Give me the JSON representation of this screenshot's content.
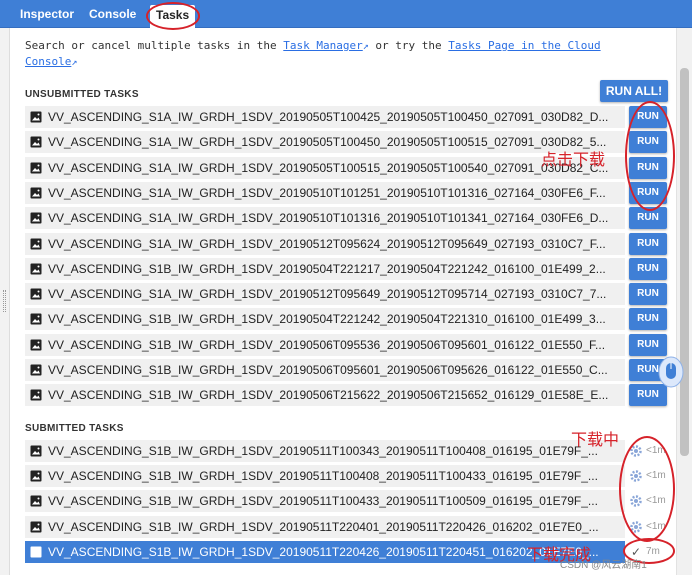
{
  "tabs": [
    {
      "label": "Inspector",
      "active": false
    },
    {
      "label": "Console",
      "active": false
    },
    {
      "label": "Tasks",
      "active": true
    }
  ],
  "intro": {
    "text1": "Search or cancel multiple tasks in the ",
    "link1": "Task Manager",
    "text2": " or try the ",
    "link2": "Tasks Page in the Cloud Console"
  },
  "unsubmitted": {
    "title": "UNSUBMITTED TASKS",
    "run_all_label": "RUN ALL!",
    "run_label": "RUN",
    "tasks": [
      "VV_ASCENDING_S1A_IW_GRDH_1SDV_20190505T100425_20190505T100450_027091_030D82_D...",
      "VV_ASCENDING_S1A_IW_GRDH_1SDV_20190505T100450_20190505T100515_027091_030D82_5...",
      "VV_ASCENDING_S1A_IW_GRDH_1SDV_20190505T100515_20190505T100540_027091_030D82_C...",
      "VV_ASCENDING_S1A_IW_GRDH_1SDV_20190510T101251_20190510T101316_027164_030FE6_F...",
      "VV_ASCENDING_S1A_IW_GRDH_1SDV_20190510T101316_20190510T101341_027164_030FE6_D...",
      "VV_ASCENDING_S1A_IW_GRDH_1SDV_20190512T095624_20190512T095649_027193_0310C7_F...",
      "VV_ASCENDING_S1B_IW_GRDH_1SDV_20190504T221217_20190504T221242_016100_01E499_2...",
      "VV_ASCENDING_S1A_IW_GRDH_1SDV_20190512T095649_20190512T095714_027193_0310C7_7...",
      "VV_ASCENDING_S1B_IW_GRDH_1SDV_20190504T221242_20190504T221310_016100_01E499_3...",
      "VV_ASCENDING_S1B_IW_GRDH_1SDV_20190506T095536_20190506T095601_016122_01E550_F...",
      "VV_ASCENDING_S1B_IW_GRDH_1SDV_20190506T095601_20190506T095626_016122_01E550_C...",
      "VV_ASCENDING_S1B_IW_GRDH_1SDV_20190506T215622_20190506T215652_016129_01E58E_E..."
    ]
  },
  "submitted": {
    "title": "SUBMITTED TASKS",
    "tasks": [
      {
        "name": "VV_ASCENDING_S1B_IW_GRDH_1SDV_20190511T100343_20190511T100408_016195_01E79F_...",
        "status": "<1m"
      },
      {
        "name": "VV_ASCENDING_S1B_IW_GRDH_1SDV_20190511T100408_20190511T100433_016195_01E79F_...",
        "status": "<1m"
      },
      {
        "name": "VV_ASCENDING_S1B_IW_GRDH_1SDV_20190511T100433_20190511T100509_016195_01E79F_...",
        "status": "<1m"
      },
      {
        "name": "VV_ASCENDING_S1B_IW_GRDH_1SDV_20190511T220401_20190511T220426_016202_01E7E0_...",
        "status": "<1m"
      },
      {
        "name": "VV_ASCENDING_S1B_IW_GRDH_1SDV_20190511T220426_20190511T220451_016202_01E7E0_...",
        "status": "7m"
      }
    ]
  },
  "annotations": {
    "click_download": "点击下载",
    "downloading": "下载中",
    "download_done": "下载完成"
  },
  "watermark": "CSDN @风云湖南1",
  "colors": {
    "accent": "#3f7fd6",
    "annotation": "#d6222a"
  }
}
